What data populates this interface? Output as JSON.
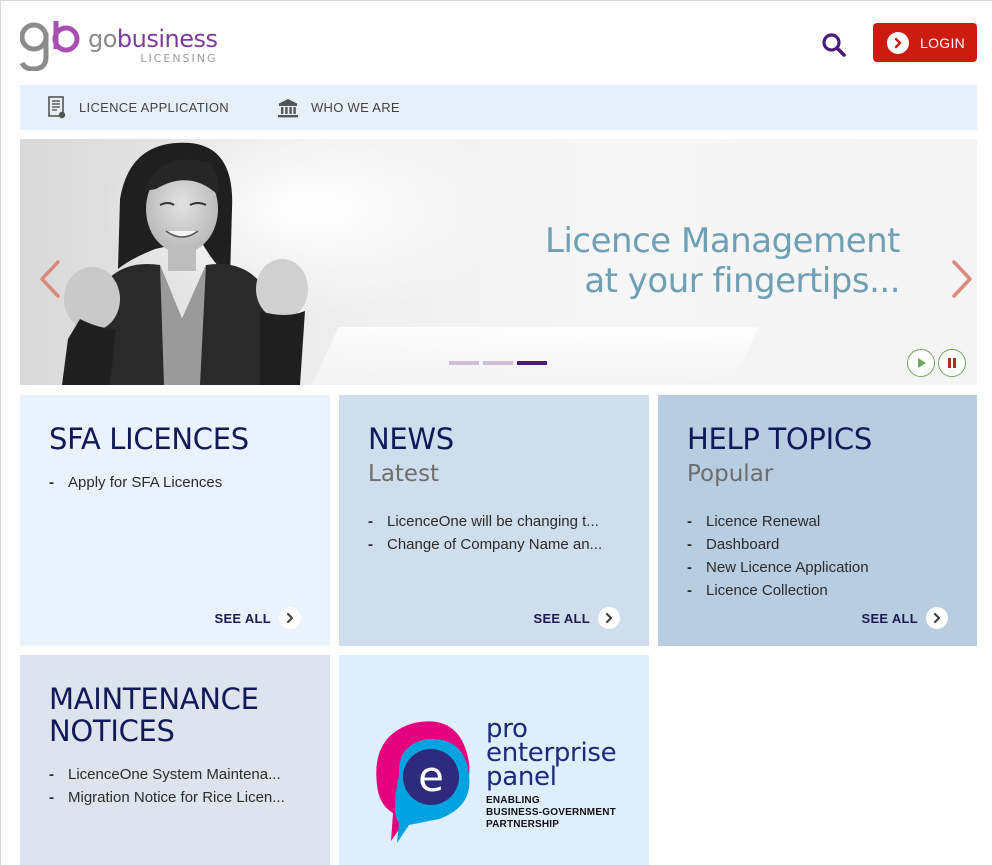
{
  "header": {
    "logo_brand_go": "go",
    "logo_brand_business": "business",
    "logo_sub": "LICENSING",
    "login_label": "LOGIN"
  },
  "nav": {
    "items": [
      {
        "label": "LICENCE APPLICATION",
        "icon": "document-certificate-icon"
      },
      {
        "label": "WHO WE ARE",
        "icon": "institution-building-icon"
      }
    ]
  },
  "banner": {
    "line1": "Licence Management",
    "line2": "at your fingertips...",
    "slides": 3,
    "active_slide": 3,
    "colors": {
      "text": "#6f9fb4",
      "arrow": "#d98a7f"
    }
  },
  "cards": {
    "sfa": {
      "title": "SFA LICENCES",
      "items": [
        "Apply for SFA Licences"
      ],
      "see_all": "SEE ALL"
    },
    "news": {
      "title": "NEWS",
      "subtitle": "Latest",
      "items": [
        "LicenceOne will be changing t...",
        "Change of Company Name an..."
      ],
      "see_all": "SEE ALL"
    },
    "help": {
      "title": "HELP TOPICS",
      "subtitle": "Popular",
      "items": [
        "Licence Renewal",
        "Dashboard",
        "New Licence Application",
        "Licence Collection"
      ],
      "see_all": "SEE ALL"
    },
    "maintenance": {
      "title_line1": "MAINTENANCE",
      "title_line2": "NOTICES",
      "items": [
        "LicenceOne System Maintena...",
        "Migration Notice for Rice Licen..."
      ]
    },
    "pep": {
      "word1": "pro",
      "word2": "enterprise",
      "word3": "panel",
      "tag1": "ENABLING",
      "tag2": "BUSINESS-GOVERNMENT",
      "tag3": "PARTNERSHIP"
    }
  },
  "colors": {
    "brand_purple": "#7a3d9a",
    "login_red": "#cc1b0f",
    "title_navy": "#101a5a",
    "nav_bg": "#e6f0fa"
  }
}
